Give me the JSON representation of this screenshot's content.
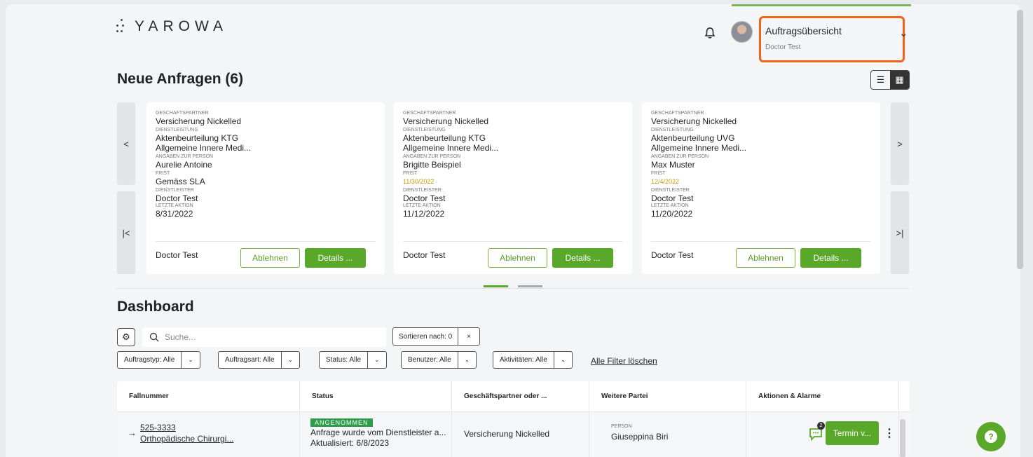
{
  "brand": {
    "logo": "YAROWA"
  },
  "account": {
    "title": "Auftragsübersicht",
    "user": "Doctor Test",
    "chevron": "⌄"
  },
  "requests": {
    "title": "Neue Anfragen (6)",
    "nav": {
      "prev": "<",
      "next": ">",
      "first": "|<",
      "last": ">|"
    },
    "labels": {
      "partner": "GESCHAFTSPARTNER",
      "service": "DIENSTLEISTUNG",
      "person": "ANGABEN ZUR PERSON",
      "deadline": "FRIST",
      "provider": "DIENSTLEISTER",
      "last_action": "LETZTE AKTION"
    },
    "reject_label": "Ablehnen",
    "details_label": "Details ...",
    "cards": [
      {
        "partner": "Versicherung Nickelled",
        "service": "Aktenbeurteilung KTG",
        "service_detail": "Allgemeine Innere Medi...",
        "person": "Aurelie Antoine",
        "deadline": "Gemäss SLA",
        "provider": "Doctor  Test",
        "last_action": "8/31/2022",
        "footer_name": "Doctor Test"
      },
      {
        "partner": "Versicherung Nickelled",
        "service": "Aktenbeurteilung KTG",
        "service_detail": "Allgemeine Innere Medi...",
        "person": "Brigitte Beispiel",
        "deadline": "11/30/2022",
        "provider": "Doctor  Test",
        "last_action": "11/12/2022",
        "footer_name": "Doctor Test"
      },
      {
        "partner": "Versicherung Nickelled",
        "service": "Aktenbeurteilung UVG",
        "service_detail": "Allgemeine Innere Medi...",
        "person": "Max Muster",
        "deadline": "12/4/2022",
        "provider": "Doctor  Test",
        "last_action": "11/20/2022",
        "footer_name": "Doctor Test"
      }
    ]
  },
  "dashboard": {
    "title": "Dashboard",
    "search_placeholder": "Suche...",
    "sort_label": "Sortieren nach: 0",
    "sort_clear": "×",
    "filters": [
      "Auftragstyp: Alle",
      "Auftragsart: Alle",
      "Status: Alle",
      "Benutzer: Alle",
      "Aktivitäten: Alle"
    ],
    "clear_filters": "Alle Filter löschen",
    "columns": [
      "Fallnummer",
      "Status",
      "Geschäftspartner oder ...",
      "Weitere Partei",
      "Aktionen & Alarme"
    ],
    "rows": [
      {
        "case_number": "525-3333",
        "case_type": "Orthopädische Chirurgi...",
        "status_badge": "ANGENOMMEN",
        "status_text": "Anfrage wurde vom Dienstleister a...",
        "updated": "Aktualisiert: 6/8/2023",
        "partner": "Versicherung Nickelled",
        "party_label": "PERSON",
        "party_name": "Giuseppina Biri",
        "message_count": "2",
        "action_label": "Termin v..."
      }
    ]
  },
  "help": {
    "label": "?"
  },
  "colors": {
    "accent": "#5aa82a",
    "highlight": "#f2621b",
    "badge": "#2e9d4a",
    "date": "#c79a00"
  }
}
